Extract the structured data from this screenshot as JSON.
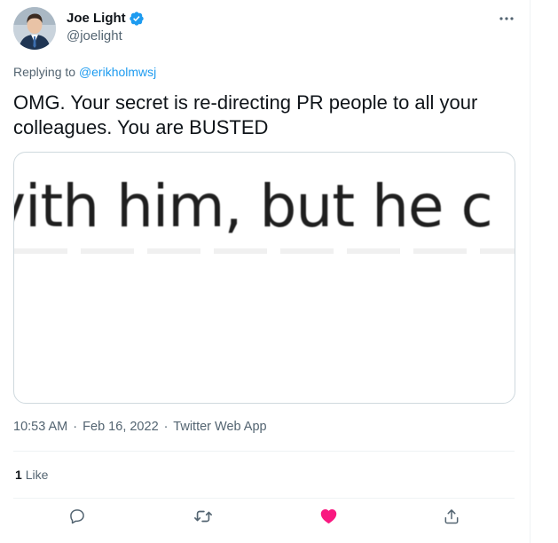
{
  "author": {
    "display_name": "Joe Light",
    "handle": "@joelight",
    "verified": true
  },
  "reply": {
    "prefix": "Replying to ",
    "to_handle": "@erikholmwsj"
  },
  "tweet": {
    "text": "OMG. Your secret is re-directing PR people to all your colleagues. You are BUSTED",
    "media_text": "vith him, but he c"
  },
  "meta": {
    "time": "10:53 AM",
    "separator": "·",
    "date": "Feb 16, 2022",
    "source": "Twitter Web App"
  },
  "stats": {
    "likes_count": "1",
    "likes_label": "Like"
  },
  "colors": {
    "link": "#1d9bf0",
    "like_active": "#f91880",
    "secondary_text": "#536471"
  },
  "icons": {
    "reply": "reply-icon",
    "retweet": "retweet-icon",
    "like": "heart-filled-icon",
    "share": "share-icon",
    "more": "more-icon",
    "verified": "verified-badge-icon"
  }
}
